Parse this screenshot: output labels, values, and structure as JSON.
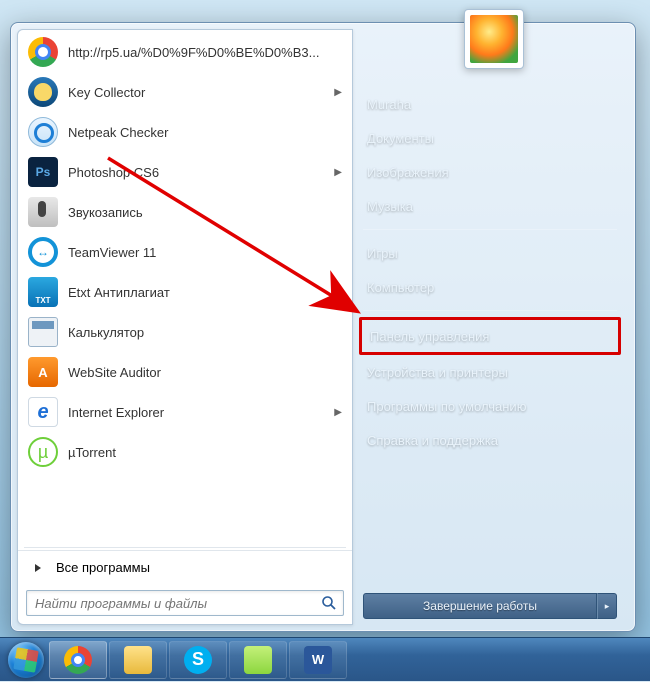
{
  "programs": [
    {
      "label": "http://rp5.ua/%D0%9F%D0%BE%D0%B3...",
      "icon": "chrome-icon",
      "arrow": false
    },
    {
      "label": "Key Collector",
      "icon": "keycollector-icon",
      "arrow": true
    },
    {
      "label": "Netpeak Checker",
      "icon": "netpeak-icon",
      "arrow": false
    },
    {
      "label": "Photoshop CS6",
      "icon": "photoshop-icon",
      "arrow": true
    },
    {
      "label": "Звукозапись",
      "icon": "microphone-icon",
      "arrow": false
    },
    {
      "label": "TeamViewer 11",
      "icon": "teamviewer-icon",
      "arrow": false
    },
    {
      "label": "Etxt Антиплагиат",
      "icon": "etxt-icon",
      "arrow": false
    },
    {
      "label": "Калькулятор",
      "icon": "calculator-icon",
      "arrow": false
    },
    {
      "label": "WebSite Auditor",
      "icon": "website-auditor-icon",
      "arrow": false
    },
    {
      "label": "Internet Explorer",
      "icon": "internet-explorer-icon",
      "arrow": true
    },
    {
      "label": "µTorrent",
      "icon": "utorrent-icon",
      "arrow": false
    }
  ],
  "all_programs_label": "Все программы",
  "search": {
    "placeholder": "Найти программы и файлы"
  },
  "right": {
    "user": "Muraha",
    "items_top": [
      "Документы",
      "Изображения",
      "Музыка"
    ],
    "items_mid": [
      "Игры",
      "Компьютер"
    ],
    "highlighted": "Панель управления",
    "items_bottom": [
      "Устройства и принтеры",
      "Программы по умолчанию",
      "Справка и поддержка"
    ]
  },
  "shutdown": {
    "label": "Завершение работы"
  },
  "taskbar": [
    {
      "name": "chrome",
      "active": true
    },
    {
      "name": "explorer",
      "active": false
    },
    {
      "name": "skype",
      "active": false
    },
    {
      "name": "notepadpp",
      "active": false
    },
    {
      "name": "word",
      "active": false
    }
  ],
  "annotation": {
    "highlight_color": "#d60000",
    "arrow_color": "#e00000"
  }
}
